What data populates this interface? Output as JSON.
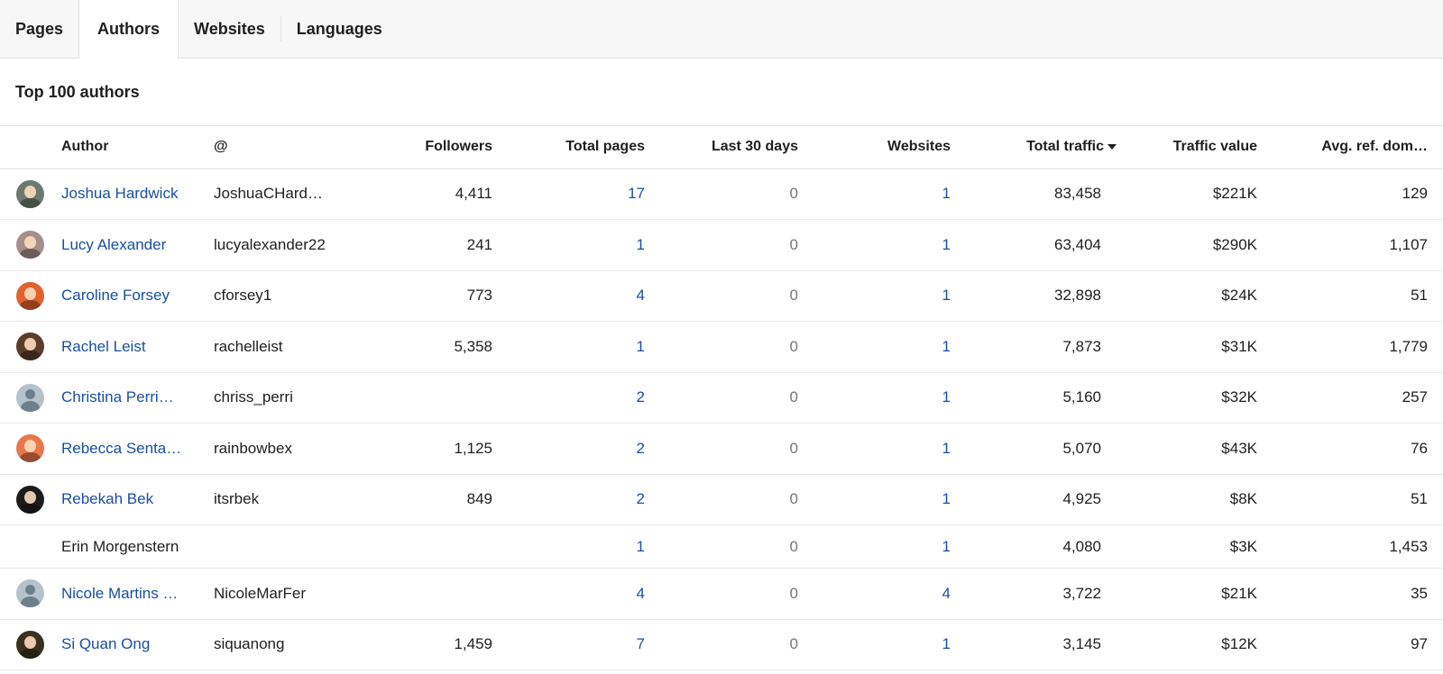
{
  "tabs": [
    {
      "label": "Pages",
      "active": false
    },
    {
      "label": "Authors",
      "active": true
    },
    {
      "label": "Websites",
      "active": false
    },
    {
      "label": "Languages",
      "active": false
    }
  ],
  "section_title": "Top 100 authors",
  "columns": {
    "author": "Author",
    "handle": "@",
    "followers": "Followers",
    "total_pages": "Total pages",
    "last_30_days": "Last 30 days",
    "websites": "Websites",
    "total_traffic": "Total traffic",
    "traffic_value": "Traffic value",
    "avg_ref_domains": "Avg. ref. dom…"
  },
  "sort": {
    "column": "total_traffic",
    "direction": "descending",
    "icon": "sort-down-icon"
  },
  "rows": [
    {
      "author": "Joshua Hardwick",
      "handle": "JoshuaCHard…",
      "followers": "4,411",
      "total_pages": "17",
      "last_30_days": "0",
      "websites": "1",
      "total_traffic": "83,458",
      "traffic_value": "$221K",
      "avg_ref_domains": "129",
      "avatar": "photo",
      "avatar_color": "#6b7a6f"
    },
    {
      "author": "Lucy Alexander",
      "handle": "lucyalexander22",
      "followers": "241",
      "total_pages": "1",
      "last_30_days": "0",
      "websites": "1",
      "total_traffic": "63,404",
      "traffic_value": "$290K",
      "avg_ref_domains": "1,107",
      "avatar": "photo",
      "avatar_color": "#a58f8a"
    },
    {
      "author": "Caroline Forsey",
      "handle": "cforsey1",
      "followers": "773",
      "total_pages": "4",
      "last_30_days": "0",
      "websites": "1",
      "total_traffic": "32,898",
      "traffic_value": "$24K",
      "avg_ref_domains": "51",
      "avatar": "photo",
      "avatar_color": "#e0622f"
    },
    {
      "author": "Rachel Leist",
      "handle": "rachelleist",
      "followers": "5,358",
      "total_pages": "1",
      "last_30_days": "0",
      "websites": "1",
      "total_traffic": "7,873",
      "traffic_value": "$31K",
      "avg_ref_domains": "1,779",
      "avatar": "photo",
      "avatar_color": "#5a3d2b"
    },
    {
      "author": "Christina Perri…",
      "handle": "chriss_perri",
      "followers": "",
      "total_pages": "2",
      "last_30_days": "0",
      "websites": "1",
      "total_traffic": "5,160",
      "traffic_value": "$32K",
      "avg_ref_domains": "257",
      "avatar": "generic",
      "avatar_color": "#b5c2cc"
    },
    {
      "author": "Rebecca Senta…",
      "handle": "rainbowbex",
      "followers": "1,125",
      "total_pages": "2",
      "last_30_days": "0",
      "websites": "1",
      "total_traffic": "5,070",
      "traffic_value": "$43K",
      "avg_ref_domains": "76",
      "avatar": "photo",
      "avatar_color": "#e9774a"
    },
    {
      "author": "Rebekah Bek",
      "handle": "itsrbek",
      "followers": "849",
      "total_pages": "2",
      "last_30_days": "0",
      "websites": "1",
      "total_traffic": "4,925",
      "traffic_value": "$8K",
      "avg_ref_domains": "51",
      "avatar": "photo",
      "avatar_color": "#1c1c1c"
    },
    {
      "author": "Erin Morgenstern",
      "handle": "",
      "followers": "",
      "total_pages": "1",
      "last_30_days": "0",
      "websites": "1",
      "total_traffic": "4,080",
      "traffic_value": "$3K",
      "avg_ref_domains": "1,453",
      "avatar": "none",
      "avatar_color": ""
    },
    {
      "author": "Nicole Martins …",
      "handle": "NicoleMarFer",
      "followers": "",
      "total_pages": "4",
      "last_30_days": "0",
      "websites": "4",
      "total_traffic": "3,722",
      "traffic_value": "$21K",
      "avg_ref_domains": "35",
      "avatar": "generic",
      "avatar_color": "#b5c2cc"
    },
    {
      "author": "Si Quan Ong",
      "handle": "siquanong",
      "followers": "1,459",
      "total_pages": "7",
      "last_30_days": "0",
      "websites": "1",
      "total_traffic": "3,145",
      "traffic_value": "$12K",
      "avg_ref_domains": "97",
      "avatar": "photo",
      "avatar_color": "#3a3020"
    }
  ]
}
